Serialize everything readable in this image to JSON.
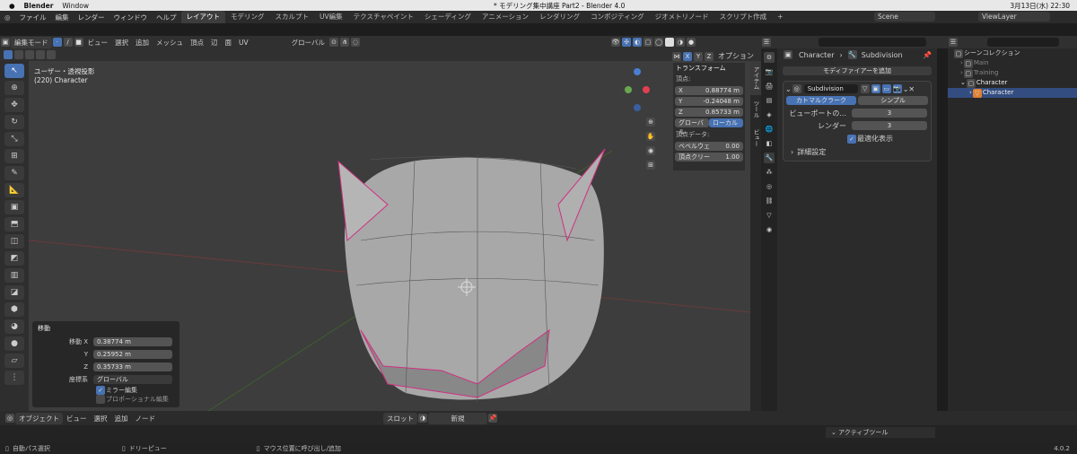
{
  "macbar": {
    "app": "Blender",
    "window": "Window",
    "title": "* モデリング集中講座 Part2 - Blender 4.0",
    "date": "3月13日(水) 22:30"
  },
  "topmenu": [
    "ファイル",
    "編集",
    "レンダー",
    "ウィンドウ",
    "ヘルプ"
  ],
  "workspaces": [
    "レイアウト",
    "モデリング",
    "スカルプト",
    "UV編集",
    "テクスチャペイント",
    "シェーディング",
    "アニメーション",
    "レンダリング",
    "コンポジティング",
    "ジオメトリノード",
    "スクリプト作成"
  ],
  "scene": "Scene",
  "viewlayer": "ViewLayer",
  "vpheader": {
    "mode": "編集モード",
    "menus": [
      "ビュー",
      "選択",
      "追加",
      "メッシュ",
      "頂点",
      "辺",
      "面",
      "UV"
    ],
    "orientation": "グローバル",
    "option": "オプション",
    "axes": [
      "X",
      "Y",
      "Z"
    ]
  },
  "viewport": {
    "view_name": "ユーザー・透視投影",
    "object": "(220) Character"
  },
  "transform": {
    "title": "トランスフォーム",
    "vertex": "頂点:",
    "x_label": "X",
    "x": "0.88774 m",
    "y_label": "Y",
    "y": "-0.24048 m",
    "z_label": "Z",
    "z": "0.85733 m",
    "global": "グローバル",
    "local": "ローカル",
    "vdata": "頂点データ:",
    "bevel_label": "ベベルウェ",
    "bevel": "0.00",
    "crease_label": "頂点クリー",
    "crease": "1.00"
  },
  "sidetabs": [
    "アイテム",
    "ツール",
    "ビュー"
  ],
  "operator": {
    "title": "移動",
    "move_x_label": "移動 X",
    "x": "0.38774 m",
    "y_label": "Y",
    "y": "0.25952 m",
    "z_label": "Z",
    "z": "0.35733 m",
    "orient_label": "座標系",
    "orient": "グローバル",
    "mirror": "ミラー編集",
    "proportional": "プロポーショナル編集"
  },
  "props": {
    "breadcrumb_obj": "Character",
    "breadcrumb_mod": "Subdivision",
    "add_modifier": "モディファイアーを追加",
    "mod_name": "Subdivision",
    "catmull": "カトマルクラーク",
    "simple": "シンプル",
    "viewport_label": "ビューポートの...",
    "viewport_val": "3",
    "render_label": "レンダー",
    "render_val": "3",
    "optimal": "最適化表示",
    "advanced": "詳細設定"
  },
  "outliner": {
    "root": "シーンコレクション",
    "items": [
      "Main",
      "Training",
      "Character",
      "Character"
    ]
  },
  "vpfooter": {
    "mode": "オブジェクト",
    "menus": [
      "ビュー",
      "選択",
      "追加",
      "ノード"
    ],
    "slot": "スロット",
    "new": "新規"
  },
  "activetool": "アクティブツール",
  "status": {
    "a": "自動パス選択",
    "b": "ドリーピュー",
    "c": "マウス位置に呼び出し/追加",
    "version": "4.0.2"
  }
}
